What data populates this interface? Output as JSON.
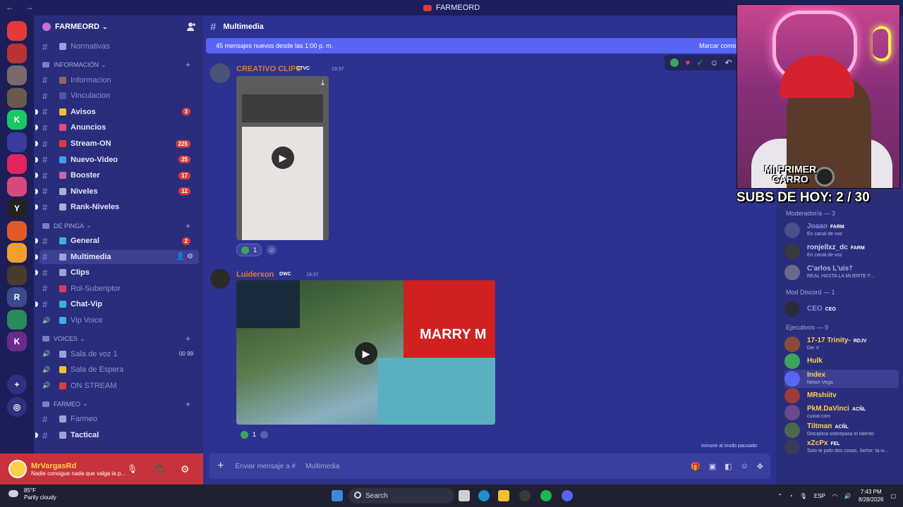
{
  "window": {
    "title": "FARMEORD"
  },
  "servers": [
    {
      "label": "",
      "color": "#e63a3a",
      "count": "1K+"
    },
    {
      "label": "",
      "color": "#b83434",
      "count": "290"
    },
    {
      "label": "",
      "color": "#7a6a6a",
      "count": "134"
    },
    {
      "label": "",
      "color": "#6b5a4a",
      "count": ""
    },
    {
      "label": "K",
      "color": "#18c964",
      "count": ""
    },
    {
      "label": "",
      "color": "#3a3aa0",
      "count": "6K+"
    },
    {
      "label": "",
      "color": "#e0245e",
      "count": ""
    },
    {
      "label": "",
      "color": "#d8487a",
      "count": "288"
    },
    {
      "label": "Y",
      "color": "#222",
      "count": ""
    },
    {
      "label": "",
      "color": "#e05a2a",
      "count": "267"
    },
    {
      "label": "",
      "color": "#f0a02a",
      "count": "1K+"
    },
    {
      "label": "",
      "color": "#4a3a2a",
      "count": ""
    },
    {
      "label": "R",
      "color": "#3a4a8a",
      "count": ""
    },
    {
      "label": "",
      "color": "#2a8a5a",
      "count": "173"
    },
    {
      "label": "K",
      "color": "#6a2a8a",
      "count": "264"
    }
  ],
  "guild": {
    "name": "FARMEORD"
  },
  "channels": [
    {
      "name": "Normativas",
      "type": "rules",
      "color": "#9ea0d8",
      "muted": true,
      "badge": ""
    },
    {
      "category": "INFORMACIÓN"
    },
    {
      "name": "Informacion",
      "color": "#8a6a5a",
      "muted": true,
      "badge": ""
    },
    {
      "name": "Vinculacion",
      "color": "#4a5a9a",
      "muted": true,
      "badge": ""
    },
    {
      "name": "Avisos",
      "color": "#f0c030",
      "muted": false,
      "badge": "3"
    },
    {
      "name": "Anuncios",
      "color": "#e04a8a",
      "muted": false,
      "badge": ""
    },
    {
      "name": "Stream-ON",
      "color": "#e03a3a",
      "muted": false,
      "badge": "225"
    },
    {
      "name": "Nuevo-Video",
      "color": "#3aa0e0",
      "muted": false,
      "badge": "25"
    },
    {
      "name": "Booster",
      "color": "#c06aa0",
      "muted": false,
      "badge": "17"
    },
    {
      "name": "Niveles",
      "color": "#aab0d8",
      "muted": false,
      "badge": "12"
    },
    {
      "name": "Rank-Niveles",
      "color": "#aab0d8",
      "muted": false,
      "badge": ""
    },
    {
      "category": "DE PINGA"
    },
    {
      "name": "General",
      "color": "#3ab0e0",
      "muted": false,
      "badge": "2"
    },
    {
      "name": "Multimedia",
      "color": "#9ea0d8",
      "muted": false,
      "badge": "",
      "active": true
    },
    {
      "name": "Clips",
      "color": "#9ea0d8",
      "muted": false,
      "badge": ""
    },
    {
      "name": "Rol-Suberiptor",
      "color": "#e03a5a",
      "muted": true,
      "badge": ""
    },
    {
      "name": "Chat-Vip",
      "color": "#3ab0e0",
      "muted": false,
      "badge": ""
    },
    {
      "name": "Vip Voice",
      "color": "#3ab0e0",
      "muted": true,
      "badge": ""
    },
    {
      "category": "VOICES"
    },
    {
      "name": "Sala de voz 1",
      "color": "#9ea0d8",
      "muted": true,
      "badge": "",
      "voice": "00 99"
    },
    {
      "name": "Sala de Espera",
      "color": "#f0c030",
      "muted": true,
      "badge": ""
    },
    {
      "name": "ON STREAM",
      "color": "#e03a3a",
      "muted": true,
      "badge": ""
    },
    {
      "category": "FARMEO"
    },
    {
      "name": "Farmeo",
      "color": "#9ea0d8",
      "muted": true,
      "badge": ""
    },
    {
      "name": "Tactical",
      "color": "#9ea0d8",
      "muted": false,
      "badge": ""
    }
  ],
  "user": {
    "name": "MrVargasRd",
    "status": "Nadie consigue nada que valga la p..."
  },
  "channel_header": {
    "name": "Multimedia"
  },
  "banner": {
    "text": "45 mensajes nuevos desde las 1:00 p. m.",
    "action": "Marcar como l"
  },
  "messages": [
    {
      "author": "CREATIVO CLIPS",
      "author_color": "#e07a30",
      "tag": "CTVC",
      "time": "19:37",
      "reaction_count": "1"
    },
    {
      "author": "Luiderxon",
      "author_color": "#e07a30",
      "tag": "DWC",
      "time": "19:37",
      "reaction_count": "1",
      "video_text": "MARRY M"
    }
  ],
  "composer": {
    "placeholder": "Enviar mensaje a #",
    "channel": "Multimedia"
  },
  "immune": "Inmune al modo pausado",
  "overlay": {
    "car_text": "MI PRIMER CARRO",
    "subs": "SUBS DE HOY: 2 / 30"
  },
  "members": {
    "mod_header": "Moderador/a — 3",
    "moderators": [
      {
        "name": "Joaao",
        "color": "#8a8ddb",
        "tag": "FARM",
        "sub": "En canal de voz"
      },
      {
        "name": "ronjellxz_dc",
        "color": "#d0d2ff",
        "tag": "FARM",
        "sub": "En canal de voz"
      },
      {
        "name": "C'arlos L'uis†",
        "color": "#b0b2e0",
        "tag": "",
        "sub": "REAL HASTA LA MUERTE F..."
      }
    ],
    "discord_header": "Mod Discord — 1",
    "discord_mods": [
      {
        "name": "CEO",
        "color": "#8a8ddb",
        "tag": "CEO",
        "sub": ""
      }
    ],
    "exec_header": "Ejecutivos — 9",
    "executives": [
      {
        "name": "17-17 Trinity-",
        "color": "#ffd24a",
        "tag": "RDJV",
        "sub": "Dei V"
      },
      {
        "name": "Hulk",
        "color": "#ffd24a",
        "tag": "",
        "sub": ""
      },
      {
        "name": "Index",
        "color": "#ffd24a",
        "tag": "",
        "sub": "Neton Vega"
      },
      {
        "name": "MRshiitv",
        "color": "#ffd24a",
        "tag": "",
        "sub": ""
      },
      {
        "name": "PkM.DaVinci",
        "color": "#ffd24a",
        "tag": "ACÑL",
        "sub": "cuxial.com"
      },
      {
        "name": "Tiltman",
        "color": "#ffd24a",
        "tag": "ACÑL",
        "sub": "Disciplina sobrepasa el talento"
      },
      {
        "name": "xZcPx",
        "color": "#ffd24a",
        "tag": "FEL",
        "sub": "Solo te pido dos cosas, Señor: la vi..."
      }
    ]
  },
  "taskbar": {
    "temp": "85°F",
    "weather": "Partly cloudy",
    "search": "Search",
    "lang": "ESP",
    "time": "7:43 PM",
    "date": "8/28/2026"
  }
}
